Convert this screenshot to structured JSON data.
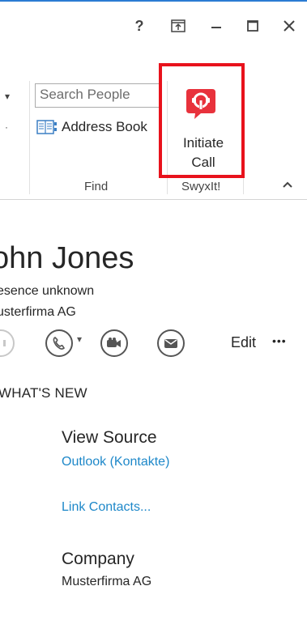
{
  "window": {
    "help_label": "?",
    "restore_label": "⇱",
    "minimize_label": "—",
    "maximize_label": "☐",
    "close_label": "✕"
  },
  "ribbon": {
    "dropdown_arrow": "▾",
    "search_placeholder": "Search People",
    "address_book_label": "Address Book",
    "find_group_label": "Find",
    "swyxit_group_label": "SwyxIt!",
    "initiate_call_line1": "Initiate",
    "initiate_call_line2": "Call",
    "collapse_label": "^"
  },
  "contact": {
    "name": "ohn Jones",
    "presence": "esence unknown",
    "company_line": "usterfirma AG",
    "edit_label": "Edit",
    "more_label": "•••"
  },
  "details": {
    "section_title": "WHAT'S NEW",
    "view_source_label": "View Source",
    "view_source_value": "Outlook (Kontakte)",
    "link_contacts_label": "Link Contacts...",
    "company_label": "Company",
    "company_value": "Musterfirma AG"
  },
  "colors": {
    "accent_blue": "#2b7cd3",
    "highlight_red": "#e8121c",
    "link_blue": "#1e88c9",
    "swyx_red": "#e8323c"
  }
}
